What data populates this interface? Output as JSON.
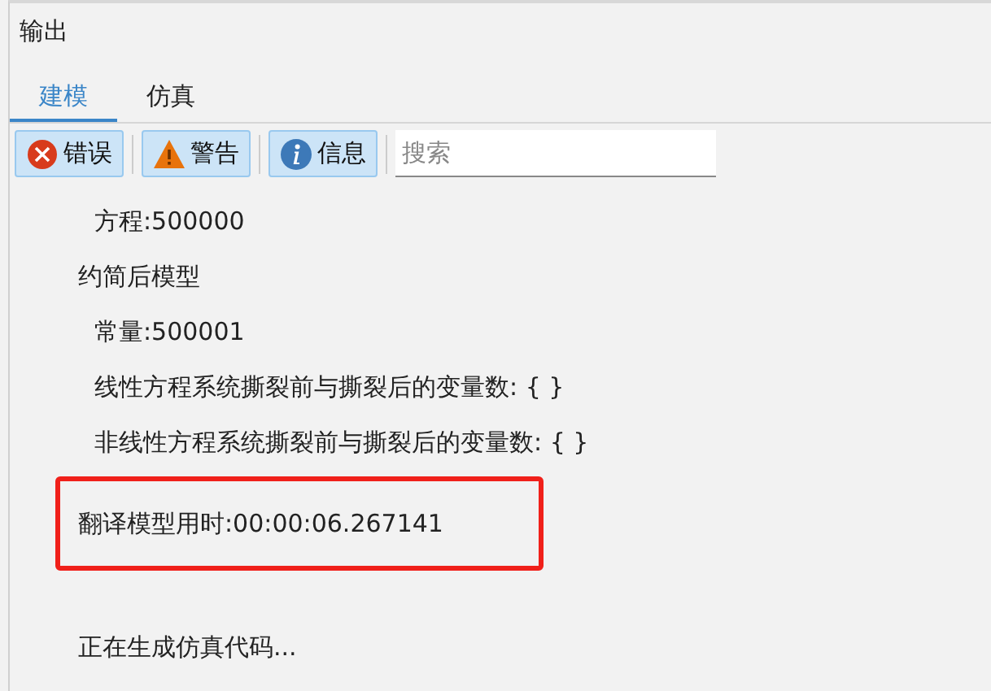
{
  "panel": {
    "title": "输出"
  },
  "tabs": [
    {
      "label": "建模",
      "selected": true
    },
    {
      "label": "仿真",
      "selected": false
    }
  ],
  "filters": [
    {
      "kind": "error",
      "label": "错误",
      "selected": true
    },
    {
      "kind": "warning",
      "label": "警告",
      "selected": true
    },
    {
      "kind": "info",
      "label": "信息",
      "selected": true
    }
  ],
  "search": {
    "placeholder": "搜索"
  },
  "log": [
    {
      "children": [
        {
          "text": "方程:500000"
        }
      ]
    },
    {
      "text": "约简后模型",
      "children": [
        {
          "text": "常量:500001"
        },
        {
          "text": "线性方程系统撕裂前与撕裂后的变量数: { }"
        },
        {
          "text": "非线性方程系统撕裂前与撕裂后的变量数: { }"
        }
      ]
    },
    {
      "text": "翻译模型用时:00:00:06.267141",
      "highlighted": true
    },
    {
      "text": "正在生成仿真代码...",
      "gap": true
    }
  ]
}
